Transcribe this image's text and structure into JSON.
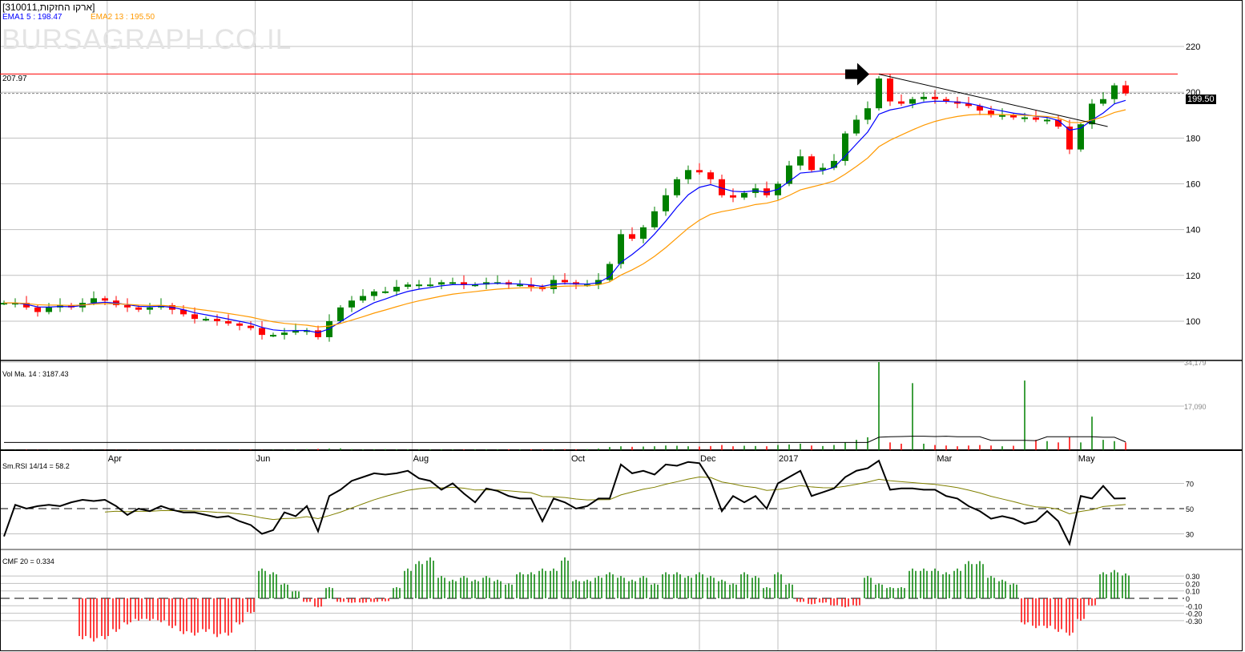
{
  "header": {
    "title": "[310011,ארקו החזקות]",
    "ema1_label": "EMA1 5 : 198.47",
    "ema2_label": "EMA2 13 : 195.50",
    "watermark": "BURSAGRAPH.CO.IL"
  },
  "colors": {
    "up": "#008000",
    "down": "#ff0000",
    "ema1": "#0000ff",
    "ema2": "#ff9900",
    "resistance": "#ff0000",
    "rsi_signal": "#808000"
  },
  "chart_data": [
    {
      "type": "candlestick",
      "title": "310011",
      "ylim": [
        85,
        225
      ],
      "yticks": [
        100,
        120,
        140,
        160,
        180,
        200,
        220
      ],
      "x_labels": [
        {
          "label": "Apr",
          "index": 9.2
        },
        {
          "label": "Jun",
          "index": 22.4
        },
        {
          "label": "Aug",
          "index": 36.4
        },
        {
          "label": "Oct",
          "index": 50.5
        },
        {
          "label": "Dec",
          "index": 62
        },
        {
          "label": "2017",
          "index": 69
        },
        {
          "label": "Mar",
          "index": 83.1
        },
        {
          "label": "May",
          "index": 95.7
        }
      ],
      "close": [
        108,
        108,
        106,
        104,
        106,
        107,
        106,
        108,
        110,
        109,
        107,
        106,
        105,
        106,
        107,
        105,
        103,
        101,
        101,
        100,
        99,
        98,
        97,
        94,
        94,
        95,
        96,
        96,
        93,
        100,
        106,
        109,
        111,
        113,
        113,
        115,
        116,
        116,
        116,
        117,
        117,
        116,
        116,
        117,
        117,
        116,
        116,
        115,
        114,
        118,
        117,
        116,
        116,
        118,
        125,
        138,
        136,
        141,
        148,
        155,
        162,
        166,
        165,
        162,
        155,
        154,
        156,
        158,
        155,
        160,
        168,
        172,
        166,
        167,
        170,
        182,
        188,
        193,
        206,
        196,
        195,
        197,
        198,
        197,
        196,
        195,
        194,
        192,
        190,
        190,
        189,
        189,
        188,
        188,
        185,
        175,
        186,
        195,
        197,
        203,
        199.5
      ],
      "resistance_level": 207.97,
      "resistance_label": "207.97",
      "last_price": 199.5,
      "last_price_label": "199.50",
      "trendline": {
        "from": {
          "index": 78,
          "price": 207.9
        },
        "to": {
          "index": 98.4,
          "price": 185
        }
      },
      "ema_periods": [
        5,
        13
      ]
    },
    {
      "type": "bar",
      "title": "Vol Ma. 14 : 3187.43",
      "ylim": [
        0,
        34179
      ],
      "yticks": [
        {
          "v": 34179,
          "label": "34,179"
        },
        {
          "v": 17090,
          "label": "17,090"
        }
      ],
      "values": [
        100,
        100,
        150,
        100,
        120,
        100,
        90,
        80,
        100,
        120,
        100,
        90,
        100,
        80,
        120,
        100,
        90,
        110,
        100,
        90,
        100,
        120,
        150,
        100,
        200,
        180,
        300,
        400,
        500,
        600,
        700,
        400,
        300,
        350,
        400,
        300,
        300,
        250,
        300,
        350,
        300,
        250,
        300,
        300,
        250,
        300,
        300,
        350,
        400,
        300,
        400,
        350,
        400,
        600,
        1200,
        1500,
        1300,
        1400,
        1500,
        1800,
        1700,
        1500,
        1400,
        1600,
        2000,
        1500,
        1700,
        1600,
        1500,
        2000,
        2200,
        2500,
        1800,
        1600,
        2000,
        3000,
        4000,
        5000,
        34179,
        3000,
        2500,
        26000,
        2500,
        2000,
        1800,
        1500,
        1800,
        2000,
        1800,
        1500,
        1700,
        27000,
        4000,
        3500,
        3000,
        5000,
        3000,
        13000,
        4000,
        3500,
        3000
      ],
      "ma_values": [
        3000,
        3000,
        3000,
        3000,
        3000,
        3000,
        3000,
        3000,
        3000,
        3000,
        3000,
        3000,
        3000,
        3000,
        3000,
        3000,
        3000,
        3000,
        3000,
        3000,
        3000,
        3000,
        3000,
        3000,
        3000,
        3000,
        3000,
        3000,
        3000,
        3000,
        3000,
        3000,
        3000,
        3000,
        3000,
        3000,
        3000,
        3000,
        3000,
        3000,
        3000,
        3000,
        3000,
        3000,
        3000,
        3000,
        3000,
        3000,
        3000,
        3000,
        3000,
        3000,
        3000,
        3000,
        3000,
        3000,
        3000,
        3000,
        3000,
        3000,
        3000,
        3000,
        3000,
        3000,
        3000,
        3000,
        3000,
        3000,
        3000,
        3000,
        3000,
        3000,
        3000,
        3000,
        3000,
        3000,
        3000,
        3000,
        5000,
        5200,
        5300,
        5400,
        5400,
        5300,
        5400,
        5200,
        5200,
        5200,
        3800,
        3800,
        3800,
        3800,
        3700,
        5200,
        5200,
        5200,
        5200,
        5200,
        5000,
        5000,
        3187.43
      ]
    },
    {
      "type": "line",
      "title": "Sm.RSI 14/14 = 58.2",
      "ylim": [
        20,
        95
      ],
      "yticks": [
        70,
        50,
        30
      ],
      "reference": 50,
      "values": [
        28,
        53,
        50,
        52,
        53,
        52,
        55,
        57,
        56,
        57,
        52,
        45,
        50,
        48,
        52,
        49,
        47,
        47,
        45,
        43,
        44,
        40,
        37,
        30,
        33,
        47,
        44,
        52,
        32,
        60,
        65,
        72,
        75,
        78,
        77,
        78,
        80,
        74,
        72,
        65,
        70,
        62,
        55,
        66,
        64,
        60,
        58,
        58,
        40,
        58,
        55,
        50,
        52,
        58,
        58,
        85,
        78,
        80,
        77,
        85,
        84,
        87,
        86,
        72,
        48,
        60,
        55,
        60,
        50,
        70,
        75,
        80,
        60,
        63,
        66,
        75,
        80,
        82,
        88,
        65,
        66,
        66,
        65,
        65,
        60,
        58,
        52,
        48,
        42,
        44,
        42,
        38,
        40,
        48,
        40,
        22,
        60,
        58,
        68,
        58,
        58.2
      ],
      "signal_period": 14
    },
    {
      "type": "bar",
      "title": "CMF 20 = 0.334",
      "ylim": [
        -0.65,
        0.6
      ],
      "yticks": [
        {
          "v": 0.3,
          "label": "0.30"
        },
        {
          "v": 0.2,
          "label": "0.20"
        },
        {
          "v": 0.1,
          "label": "0.10"
        },
        {
          "v": 0,
          "label": "0"
        },
        {
          "v": -0.1,
          "label": "-0.10"
        },
        {
          "v": -0.2,
          "label": "-0.20"
        },
        {
          "v": -0.3,
          "label": "-0.30"
        }
      ],
      "values": [
        0,
        0,
        0,
        0,
        0,
        0,
        0,
        -0.55,
        -0.58,
        -0.55,
        -0.45,
        -0.35,
        -0.3,
        -0.3,
        -0.32,
        -0.4,
        -0.48,
        -0.5,
        -0.45,
        -0.52,
        -0.5,
        -0.35,
        -0.2,
        0.4,
        0.35,
        0.2,
        0.1,
        -0.05,
        -0.12,
        0.15,
        -0.05,
        -0.06,
        -0.06,
        -0.05,
        -0.04,
        0.15,
        0.4,
        0.5,
        0.55,
        0.3,
        0.25,
        0.3,
        0.25,
        0.3,
        0.25,
        0.2,
        0.35,
        0.35,
        0.4,
        0.4,
        0.55,
        0.25,
        0.25,
        0.3,
        0.35,
        0.3,
        0.25,
        0.3,
        0.2,
        0.35,
        0.35,
        0.3,
        0.35,
        0.3,
        0.25,
        0.2,
        0.35,
        0.3,
        0.15,
        0.35,
        0.2,
        -0.05,
        -0.08,
        -0.06,
        -0.1,
        -0.12,
        -0.1,
        0.3,
        0.2,
        0.15,
        0.15,
        0.4,
        0.4,
        0.4,
        0.35,
        0.4,
        0.5,
        0.5,
        0.3,
        0.25,
        0.2,
        -0.35,
        -0.4,
        -0.4,
        -0.45,
        -0.5,
        -0.3,
        -0.1,
        0.35,
        0.38,
        0.334
      ]
    }
  ]
}
